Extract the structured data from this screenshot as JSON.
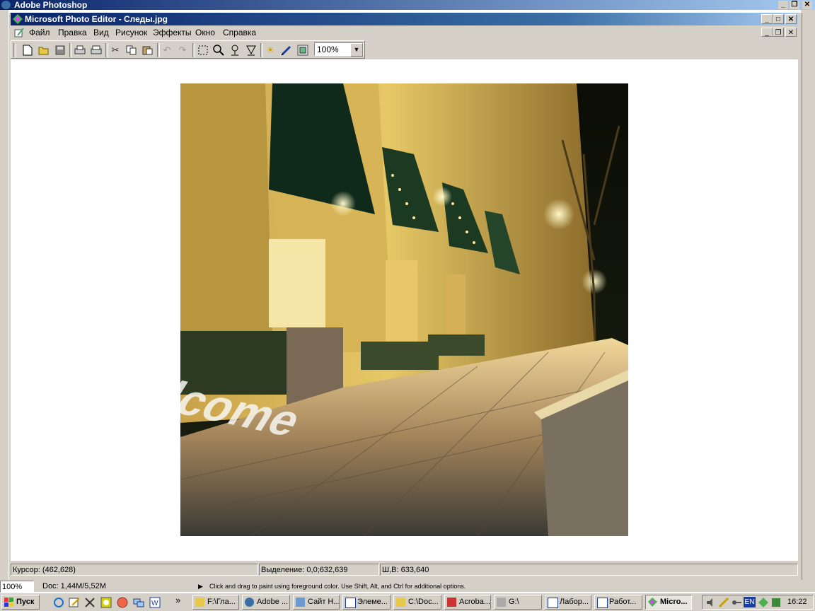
{
  "photoshop": {
    "title": "Adobe Photoshop",
    "status_zoom": "100%",
    "status_doc": "Doc: 1,44M/5,52M",
    "status_hint": "Click and drag to paint using foreground color.  Use Shift, Alt, and Ctrl for additional options."
  },
  "window": {
    "title": "Microsoft Photo Editor - Следы.jpg",
    "minimize": "_",
    "maximize": "□",
    "close": "✕",
    "restore": "❐"
  },
  "menu": {
    "items": [
      "Файл",
      "Правка",
      "Вид",
      "Рисунок",
      "Эффекты",
      "Окно",
      "Справка"
    ]
  },
  "toolbar": {
    "zoom_value": "100%",
    "buttons": [
      "new-icon",
      "open-icon",
      "save-icon",
      "print-icon",
      "print-preview-icon",
      "cut-icon",
      "copy-icon",
      "paste-icon",
      "undo-icon",
      "redo-icon",
      "select-icon",
      "zoom-icon",
      "smudge-icon",
      "sharpen-icon",
      "brightness-icon",
      "pen-icon",
      "effects-icon"
    ]
  },
  "image": {
    "sidewalk_text": "Welcome"
  },
  "status": {
    "cursor": "Курсор: (462,628)",
    "selection": "Выделение: 0,0;632,639",
    "size": "Ш,В: 633,640"
  },
  "taskbar": {
    "start": "Пуск",
    "buttons": [
      "F:\\Гла...",
      "Adobe ...",
      "Сайт Н...",
      "Элеме...",
      "C:\\Doc...",
      "Acroba...",
      "G:\\",
      "Лабор...",
      "Работ...",
      "Micro..."
    ],
    "tray_lang": "EN",
    "clock": "16:22",
    "chevron": "»"
  },
  "colors": {
    "title_active": "#0a246a",
    "window_face": "#d4d0c8"
  }
}
